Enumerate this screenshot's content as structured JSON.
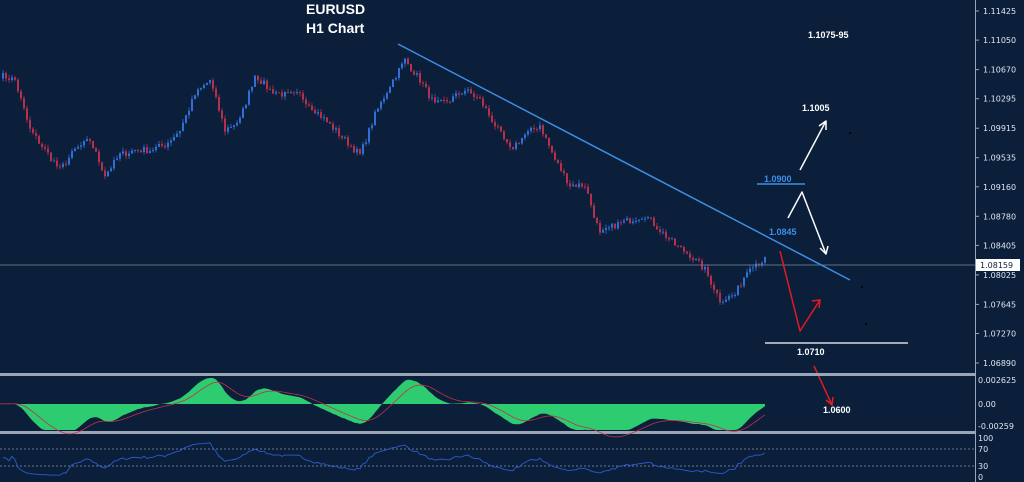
{
  "chart_data": {
    "type": "candlestick",
    "title": "EURUSD",
    "subtitle": "H1 Chart",
    "symbol": "EURUSD",
    "timeframe": "H1",
    "ylim": [
      1.0689,
      1.11425
    ],
    "y_ticks": [
      "1.11425",
      "1.11050",
      "1.10670",
      "1.10295",
      "1.09915",
      "1.09535",
      "1.09160",
      "1.08780",
      "1.08405",
      "1.08025",
      "1.07645",
      "1.07270",
      "1.06890"
    ],
    "current_price": "1.08159",
    "close_samples": [
      1.10601,
      1.10536,
      1.09892,
      1.09635,
      1.09377,
      1.09635,
      1.09763,
      1.09313,
      1.0957,
      1.09635,
      1.09635,
      1.09699,
      1.09892,
      1.10343,
      1.10536,
      1.09892,
      1.10021,
      1.10601,
      1.10407,
      1.10343,
      1.10343,
      1.1015,
      1.09957,
      1.09763,
      1.0957,
      1.10085,
      1.10472,
      1.10794,
      1.10536,
      1.10214,
      1.10279,
      1.10407,
      1.10279,
      1.09957,
      1.09635,
      1.09828,
      1.09957,
      1.09506,
      1.09184,
      1.09184,
      1.0854,
      1.08669,
      1.08733,
      1.08797,
      1.08604,
      1.08411,
      1.08282,
      1.08089,
      1.07703,
      1.07767,
      1.08153,
      1.08218
    ],
    "trendline": {
      "from_price": 1.1105,
      "to_price": 1.08
    },
    "annotations": {
      "range_target": "1.1075-95",
      "upper_target": "1.1005",
      "resistance_1": "1.0900",
      "resistance_2": "1.0845",
      "support": "1.0710",
      "lower_target": "1.0600"
    },
    "macd": {
      "y_ticks": [
        "0.002625",
        "0.00",
        "-0.00259"
      ]
    },
    "rsi": {
      "y_ticks": [
        "100",
        "70",
        "30",
        "0"
      ],
      "levels": [
        70,
        30
      ]
    },
    "colors": {
      "background": "#0b1e3a",
      "up": "#2f6fd6",
      "down": "#b5304a",
      "trendline": "#3d8fe6",
      "histogram": "#2ecc71",
      "signal": "#c0304a",
      "rsi": "#2d5bd0",
      "bullish_arrow": "#ffffff",
      "bearish_arrow": "#e21b23"
    }
  }
}
